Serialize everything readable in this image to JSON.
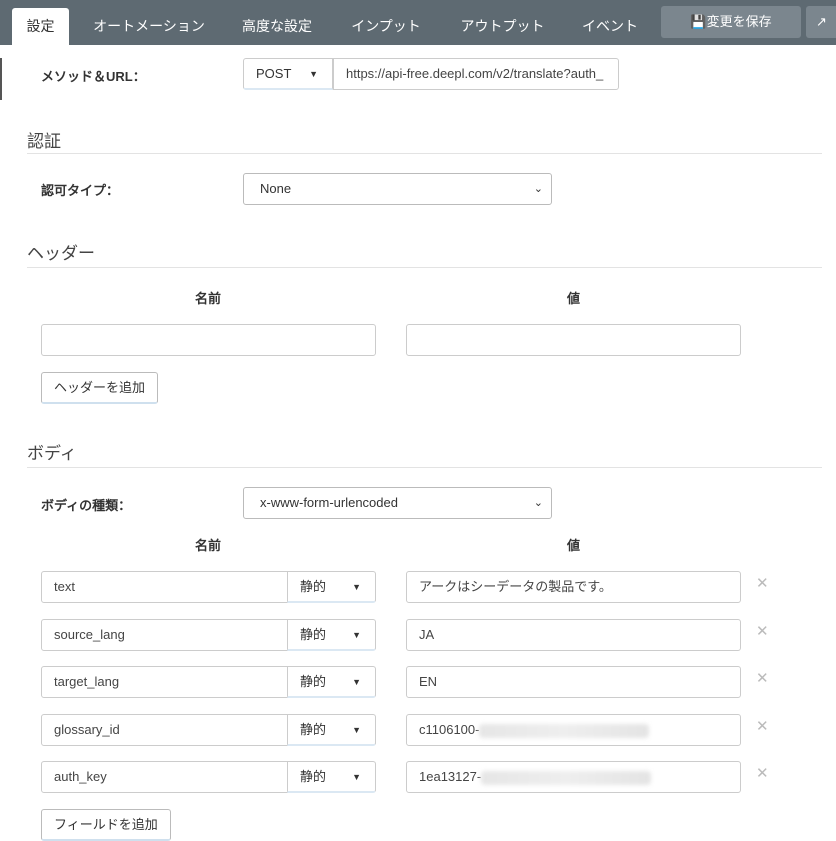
{
  "tabs": [
    {
      "label": "設定",
      "active": true
    },
    {
      "label": "オートメーション"
    },
    {
      "label": "高度な設定"
    },
    {
      "label": "インプット"
    },
    {
      "label": "アウトプット"
    },
    {
      "label": "イベント"
    }
  ],
  "save_label": "変更を保存",
  "method_url": {
    "label": "メソッド＆URL：",
    "method": "POST",
    "url": "https://api-free.deepl.com/v2/translate?auth_"
  },
  "auth": {
    "section": "認証",
    "label": "認可タイプ：",
    "value": "None"
  },
  "headers": {
    "section": "ヘッダー",
    "name_col": "名前",
    "value_col": "値",
    "name": "",
    "value": "",
    "add_label": "ヘッダーを追加"
  },
  "body": {
    "section": "ボディ",
    "type_label": "ボディの種類：",
    "type_value": "x-www-form-urlencoded",
    "name_col": "名前",
    "value_col": "値",
    "fields": [
      {
        "name": "text",
        "mode": "静的",
        "value": "アークはシーデータの製品です。"
      },
      {
        "name": "source_lang",
        "mode": "静的",
        "value": "JA"
      },
      {
        "name": "target_lang",
        "mode": "静的",
        "value": "EN"
      },
      {
        "name": "glossary_id",
        "mode": "静的",
        "value": "c1106100-"
      },
      {
        "name": "auth_key",
        "mode": "静的",
        "value": "1ea13127-"
      }
    ],
    "add_label": "フィールドを追加"
  }
}
